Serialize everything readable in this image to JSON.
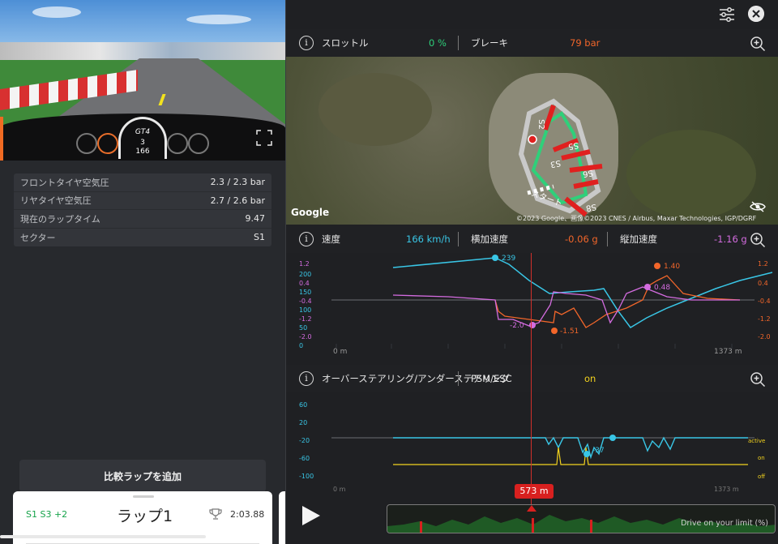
{
  "left": {
    "video": {
      "gear": "3",
      "speed": "166",
      "brand": "GT4"
    },
    "info": [
      {
        "label": "フロントタイヤ空気圧",
        "value": "2.3 / 2.3 bar"
      },
      {
        "label": "リヤタイヤ空気圧",
        "value": "2.7 / 2.6 bar"
      },
      {
        "label": "現在のラップタイム",
        "value": "9.47"
      },
      {
        "label": "セクター",
        "value": "S1"
      }
    ],
    "compare_button": "比較ラップを追加",
    "lap_card": {
      "sectors": "S1 S3 +2",
      "title": "ラップ1",
      "time": "2:03.88"
    }
  },
  "right": {
    "throttle": {
      "label": "スロットル",
      "value": "0 %",
      "color": "#2ecf7a"
    },
    "brake": {
      "label": "ブレーキ",
      "value": "79 bar",
      "color": "#f2662a"
    },
    "map": {
      "google": "Google",
      "attribution": "©2023 Google、画像©2023 CNES / Airbus, Maxar Technologies, IGP/DGRF",
      "sector_labels": [
        "S2",
        "S5",
        "S3",
        "S6",
        "S8"
      ],
      "start_label": "スタート"
    },
    "speed": {
      "label": "速度",
      "value": "166 km/h",
      "color": "#39c6e6"
    },
    "lat_g": {
      "label": "横加速度",
      "value": "-0.06 g",
      "color": "#f2662a"
    },
    "lon_g": {
      "label": "縦加速度",
      "value": "-1.16 g",
      "color": "#d46ce0"
    },
    "chart1": {
      "left_ticks_speed": [
        "200",
        "150",
        "100",
        "50",
        "0"
      ],
      "left_ticks_g": [
        "1.2",
        "0.4",
        "-0.4",
        "-1.2",
        "-2.0"
      ],
      "right_ticks": [
        "1.2",
        "0.4",
        "-0.4",
        "-1.2",
        "-2.0"
      ],
      "x_start": "0 m",
      "x_end": "1373 m",
      "annotations": [
        "239",
        "1.40",
        "0.48",
        "-1.51",
        "-2.0"
      ]
    },
    "steering": {
      "label": "オーバーステアリング/アンダーステアリング",
      "overlay": "PSM/ESC",
      "value": "on",
      "color": "#f2d21e"
    },
    "chart2": {
      "left_ticks": [
        "60",
        "20",
        "-20",
        "-60",
        "-100"
      ],
      "right_ticks": [
        "active",
        "on",
        "off"
      ],
      "x_start": "0 m",
      "x_end": "1373 m",
      "annotation": "-37"
    },
    "position": "573 m",
    "timeline_label": "Drive on your limit (%)"
  }
}
